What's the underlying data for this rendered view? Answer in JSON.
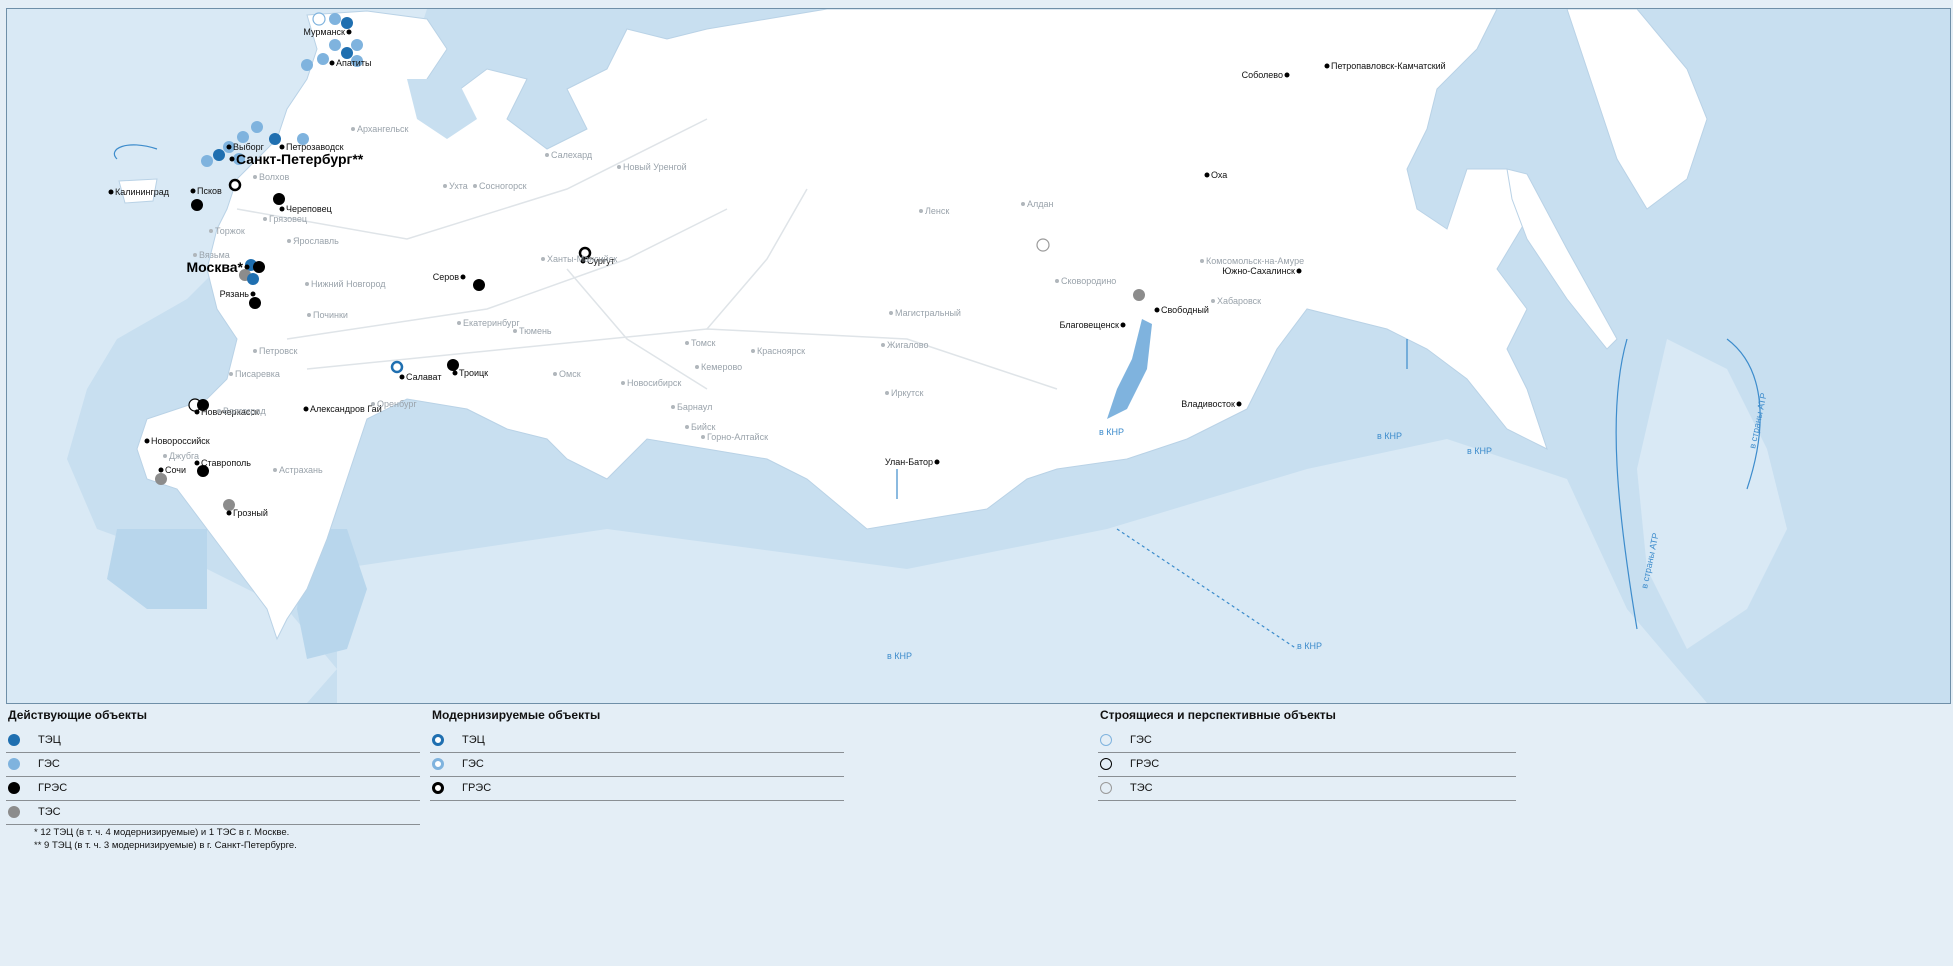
{
  "map": {
    "capitals": [
      {
        "id": "moscow",
        "label": "Москва*"
      },
      {
        "id": "spb",
        "label": "Санкт-Петербург**"
      }
    ],
    "cities": [
      {
        "id": "murmansk",
        "label": "Мурманск"
      },
      {
        "id": "apatity",
        "label": "Апатиты"
      },
      {
        "id": "vyborg",
        "label": "Выборг"
      },
      {
        "id": "petrozavodsk",
        "label": "Петрозаводск"
      },
      {
        "id": "pskov",
        "label": "Псков"
      },
      {
        "id": "kaliningrad",
        "label": "Калининград"
      },
      {
        "id": "cherepovets",
        "label": "Череповец"
      },
      {
        "id": "ryazan",
        "label": "Рязань"
      },
      {
        "id": "serov",
        "label": "Серов"
      },
      {
        "id": "surgut",
        "label": "Сургут"
      },
      {
        "id": "salavat",
        "label": "Салават"
      },
      {
        "id": "troitsk",
        "label": "Троицк"
      },
      {
        "id": "novocherkassk",
        "label": "Новочеркасск"
      },
      {
        "id": "aleksandrov_gai",
        "label": "Александров Гай"
      },
      {
        "id": "novorossiysk",
        "label": "Новороссийск"
      },
      {
        "id": "stavropol",
        "label": "Ставрополь"
      },
      {
        "id": "sochi",
        "label": "Сочи"
      },
      {
        "id": "grozny",
        "label": "Грозный"
      },
      {
        "id": "sobolevo",
        "label": "Соболево"
      },
      {
        "id": "petropavlovsk",
        "label": "Петропавловск-Камчатский"
      },
      {
        "id": "okha",
        "label": "Оха"
      },
      {
        "id": "yuzhno",
        "label": "Южно-Сахалинск"
      },
      {
        "id": "svobodny",
        "label": "Свободный"
      },
      {
        "id": "blagoveshchensk",
        "label": "Благовещенск"
      },
      {
        "id": "vladivostok",
        "label": "Владивосток"
      },
      {
        "id": "ulan_bator",
        "label": "Улан-Батор"
      }
    ],
    "towns": [
      {
        "id": "arkhangelsk",
        "label": "Архангельск"
      },
      {
        "id": "salekhard",
        "label": "Салехард"
      },
      {
        "id": "novy_urengoy",
        "label": "Новый Уренгой"
      },
      {
        "id": "ukhta",
        "label": "Ухта"
      },
      {
        "id": "sosnogorsk",
        "label": "Сосногорск"
      },
      {
        "id": "volkhov",
        "label": "Волхов"
      },
      {
        "id": "gryazovets",
        "label": "Грязовец"
      },
      {
        "id": "torzhok",
        "label": "Торжок"
      },
      {
        "id": "yaroslavl",
        "label": "Ярославль"
      },
      {
        "id": "vyazma",
        "label": "Вязьма"
      },
      {
        "id": "nizhny",
        "label": "Нижний Новгород"
      },
      {
        "id": "pochinki",
        "label": "Починки"
      },
      {
        "id": "khanty",
        "label": "Ханты-Мансийск"
      },
      {
        "id": "yekaterinburg",
        "label": "Екатеринбург"
      },
      {
        "id": "tyumen",
        "label": "Тюмень"
      },
      {
        "id": "petrovsk",
        "label": "Петровск"
      },
      {
        "id": "pisarevka",
        "label": "Писаревка"
      },
      {
        "id": "volgograd",
        "label": "Волгоград"
      },
      {
        "id": "orenburg",
        "label": "Оренбург"
      },
      {
        "id": "omsk",
        "label": "Омск"
      },
      {
        "id": "novosibirsk",
        "label": "Новосибирск"
      },
      {
        "id": "tomsk",
        "label": "Томск"
      },
      {
        "id": "kemerovo",
        "label": "Кемерово"
      },
      {
        "id": "krasnoyarsk",
        "label": "Красноярск"
      },
      {
        "id": "barnaul",
        "label": "Барнаул"
      },
      {
        "id": "biysk",
        "label": "Бийск"
      },
      {
        "id": "gorno",
        "label": "Горно-Алтайск"
      },
      {
        "id": "lensk",
        "label": "Ленск"
      },
      {
        "id": "aldan",
        "label": "Алдан"
      },
      {
        "id": "magistralny",
        "label": "Магистральный"
      },
      {
        "id": "zhigalovo",
        "label": "Жигалово"
      },
      {
        "id": "irkutsk",
        "label": "Иркутск"
      },
      {
        "id": "skovorodino",
        "label": "Сковородино"
      },
      {
        "id": "komsomolsk",
        "label": "Комсомольск-на-Амуре"
      },
      {
        "id": "khabarovsk",
        "label": "Хабаровск"
      },
      {
        "id": "dzhubga",
        "label": "Джубга"
      },
      {
        "id": "astrakhan",
        "label": "Астрахань"
      }
    ],
    "exports": {
      "knr": "в КНР",
      "atr": "в страны АТР"
    }
  },
  "legend": {
    "operating": {
      "title": "Действующие объекты",
      "items": [
        {
          "label": "ТЭЦ",
          "color": "#1f6fb0",
          "style": "filled"
        },
        {
          "label": "ГЭС",
          "color": "#7fb3de",
          "style": "filled"
        },
        {
          "label": "ГРЭС",
          "color": "#000000",
          "style": "filled"
        },
        {
          "label": "ТЭС",
          "color": "#8c8c8c",
          "style": "filled"
        }
      ]
    },
    "modernized": {
      "title": "Модернизируемые объекты",
      "items": [
        {
          "label": "ТЭЦ",
          "color": "#1f6fb0",
          "style": "ring"
        },
        {
          "label": "ГЭС",
          "color": "#7fb3de",
          "style": "ring"
        },
        {
          "label": "ГРЭС",
          "color": "#000000",
          "style": "ring"
        }
      ]
    },
    "construction": {
      "title": "Строящиеся и перспективные объекты",
      "items": [
        {
          "label": "ГЭС",
          "color": "#7fb3de",
          "style": "outline"
        },
        {
          "label": "ГРЭС",
          "color": "#000000",
          "style": "outline"
        },
        {
          "label": "ТЭС",
          "color": "#9a9a9a",
          "style": "outline"
        }
      ]
    },
    "footnotes": [
      "* 12 ТЭЦ (в т. ч. 4 модернизируемые) и 1 ТЭС в г. Москве.",
      "** 9 ТЭЦ (в т. ч. 3 модернизируемые) в г. Санкт-Петербурге."
    ]
  },
  "colors": {
    "sea": "#c8dff0",
    "land_foreign": "#d9e9f5",
    "land_russia": "#ffffff",
    "river": "#a9cbe6",
    "export_arrow": "#3d8ccc"
  }
}
